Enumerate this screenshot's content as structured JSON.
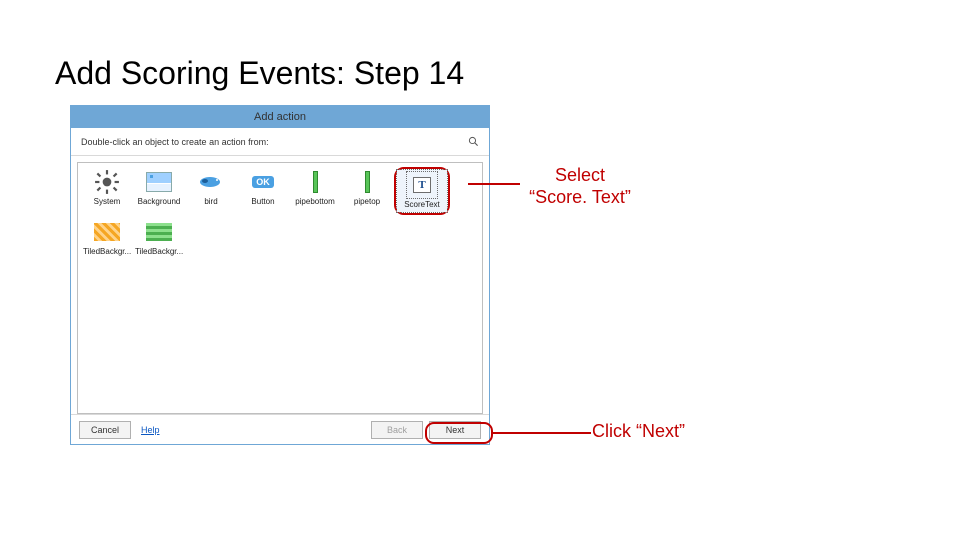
{
  "slide": {
    "title": "Add Scoring Events: Step 14"
  },
  "dialog": {
    "title": "Add action",
    "instruction": "Double-click an object to create an action from:",
    "objects_row1": [
      {
        "label": "System"
      },
      {
        "label": "Background"
      },
      {
        "label": "bird"
      },
      {
        "label": "Button"
      },
      {
        "label": "pipebottom"
      },
      {
        "label": "pipetop"
      },
      {
        "label": "ScoreText"
      }
    ],
    "objects_row2": [
      {
        "label": "TiledBackgr..."
      },
      {
        "label": "TiledBackgr..."
      }
    ],
    "buttons": {
      "cancel": "Cancel",
      "help": "Help",
      "back": "Back",
      "next": "Next"
    }
  },
  "annotations": {
    "select_scoretext_line1": "Select",
    "select_scoretext_line2": "“Score. Text”",
    "click_next": "Click “Next”"
  }
}
